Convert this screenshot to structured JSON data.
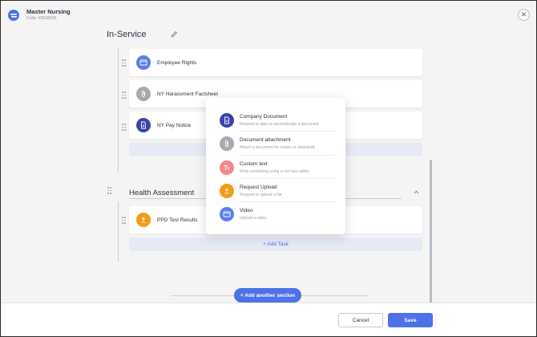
{
  "header": {
    "title": "Master Nursing",
    "code": "Code: #DEMO01",
    "logo_icon": "brand-logo-icon",
    "close_icon": "close-icon"
  },
  "sections": [
    {
      "title": "In-Service",
      "edit_icon": "pencil-icon",
      "tasks": [
        {
          "label": "Employee Rights",
          "icon": "video-icon",
          "color": "#5b7fe8"
        },
        {
          "label": "NY Harassment Factsheet",
          "icon": "paperclip-icon",
          "color": "#a7a9b2"
        },
        {
          "label": "NY Pay Notice",
          "icon": "document-icon",
          "color": "#3a44a8"
        }
      ]
    },
    {
      "title": "Health Assessment",
      "collapse_icon": "chevron-up-icon",
      "tasks": [
        {
          "label": "PPD Test Results",
          "icon": "upload-icon",
          "color": "#f29c1a"
        }
      ],
      "add_task_label": "+ Add Task"
    }
  ],
  "add_section_label": "+ Add another section",
  "task_type_menu": [
    {
      "title": "Company Document",
      "desc": "Request to sign or acknowledge a document",
      "icon": "document-icon",
      "color": "#3a44a8"
    },
    {
      "title": "Document attachment",
      "desc": "Attach a document for review or download",
      "icon": "paperclip-icon",
      "color": "#a7a9b2"
    },
    {
      "title": "Custom text",
      "desc": "Write something using a rich text editor",
      "icon": "text-icon",
      "color": "#f0888a"
    },
    {
      "title": "Request Upload",
      "desc": "Request to upload a file",
      "icon": "upload-icon",
      "color": "#f29c1a"
    },
    {
      "title": "Video",
      "desc": "Upload a video",
      "icon": "video-icon",
      "color": "#5b7fe8"
    }
  ],
  "footer": {
    "cancel_label": "Cancel",
    "save_label": "Save"
  },
  "colors": {
    "accent": "#4d72e8",
    "background": "#f4f4f5"
  }
}
